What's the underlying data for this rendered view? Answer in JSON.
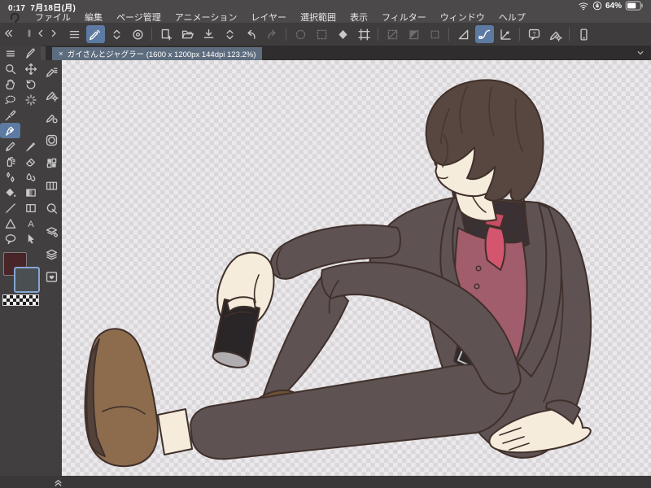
{
  "status_bar": {
    "time": "0:17",
    "date": "7月18日(月)",
    "battery_percent": "64%",
    "icons": [
      "wifi-icon",
      "orientation-lock-icon",
      "battery-icon"
    ]
  },
  "menu_bar": {
    "logo": "clip-studio-logo",
    "items": [
      "ファイル",
      "編集",
      "ページ管理",
      "アニメーション",
      "レイヤー",
      "選択範囲",
      "表示",
      "フィルター",
      "ウィンドウ",
      "ヘルプ"
    ]
  },
  "command_bar": {
    "corner_controls": [
      {
        "name": "hide-interface"
      },
      {
        "name": "edge-handle"
      },
      {
        "name": "back"
      },
      {
        "name": "forward"
      }
    ],
    "items": [
      {
        "name": "main-menu"
      },
      {
        "name": "touch-gesture",
        "state": "active"
      },
      {
        "name": "tool-switch"
      },
      {
        "name": "gesture-loop"
      },
      {
        "sep": true
      },
      {
        "name": "new-canvas"
      },
      {
        "name": "open-file"
      },
      {
        "name": "save-file"
      },
      {
        "name": "file-switch"
      },
      {
        "name": "undo"
      },
      {
        "name": "redo",
        "state": "disabled"
      },
      {
        "sep": true
      },
      {
        "name": "deselect",
        "state": "disabled"
      },
      {
        "name": "reselect",
        "state": "disabled"
      },
      {
        "name": "fill-selection"
      },
      {
        "name": "scale-rotate"
      },
      {
        "sep": true
      },
      {
        "name": "clear-selection",
        "state": "disabled"
      },
      {
        "name": "crop",
        "state": "disabled"
      },
      {
        "name": "selection-launcher",
        "state": "disabled"
      },
      {
        "sep": true
      },
      {
        "name": "snap-ruler"
      },
      {
        "name": "snap-special-ruler",
        "state": "active"
      },
      {
        "name": "snap-grid"
      },
      {
        "sep": true
      },
      {
        "name": "quick-access"
      },
      {
        "name": "pen-settings"
      },
      {
        "sep": true
      },
      {
        "name": "companion-mode"
      }
    ]
  },
  "tab_bar": {
    "active_tab": {
      "close": "×",
      "title": "ガイさんとジャグラー (1600 x 1200px 144dpi 123.2%)"
    },
    "caret": "chevron-down"
  },
  "tool_palette": {
    "rows": [
      [
        "palette-menu",
        "correct-line"
      ],
      [
        "zoom",
        "move"
      ],
      [
        "hand",
        "rotate"
      ],
      [
        "selection",
        "wand"
      ],
      [
        "eyedropper",
        null
      ],
      [
        "pen",
        null
      ],
      [
        "pencil",
        "brush"
      ],
      [
        "airbrush",
        "eraser"
      ],
      [
        "decoration",
        "blend"
      ],
      [
        "fill",
        "gradient"
      ],
      [
        "line",
        "figure"
      ],
      [
        "polygon",
        "text"
      ],
      [
        "balloon",
        "operation"
      ]
    ],
    "selected": "pen",
    "colors": {
      "main": "#472528",
      "sub": "#4a4f52",
      "selected_border": "#86a6d2",
      "transparent_chip": "checkerboard"
    }
  },
  "palette_dock": {
    "items": [
      "tool-property",
      "subtool-detail",
      "brush-size",
      "color-wheel",
      "color-set",
      "timeline",
      "navigator",
      "layer-property",
      "layers",
      "material"
    ]
  },
  "bottom_bar": {
    "expand_icon": "double-chevron-up"
  },
  "canvas": {
    "background": "transparent-checkerboard",
    "artwork": "man in dark suit with red vest and tie sitting on floor, holding black can, leaning on right hand",
    "colors": {
      "outline": "#40302b",
      "skin": "#f6ecdc",
      "hair": "#574740",
      "hairline": "#453731",
      "suit": "#5e5253",
      "shirt": "#3a3134",
      "vest": "#a15d6b",
      "tie": "#d4566e",
      "tieknot": "#c74c64",
      "belt": "#2f292c",
      "buckle": "#c3c3c3",
      "shoe": "#8d6c4d",
      "sole": "#52423a",
      "shoe2": "#6d5136",
      "can": "#2a2527",
      "cantop": "#b0adb0",
      "iris": "#ccd0d4"
    },
    "ui_accent": "#5d7aa2"
  }
}
